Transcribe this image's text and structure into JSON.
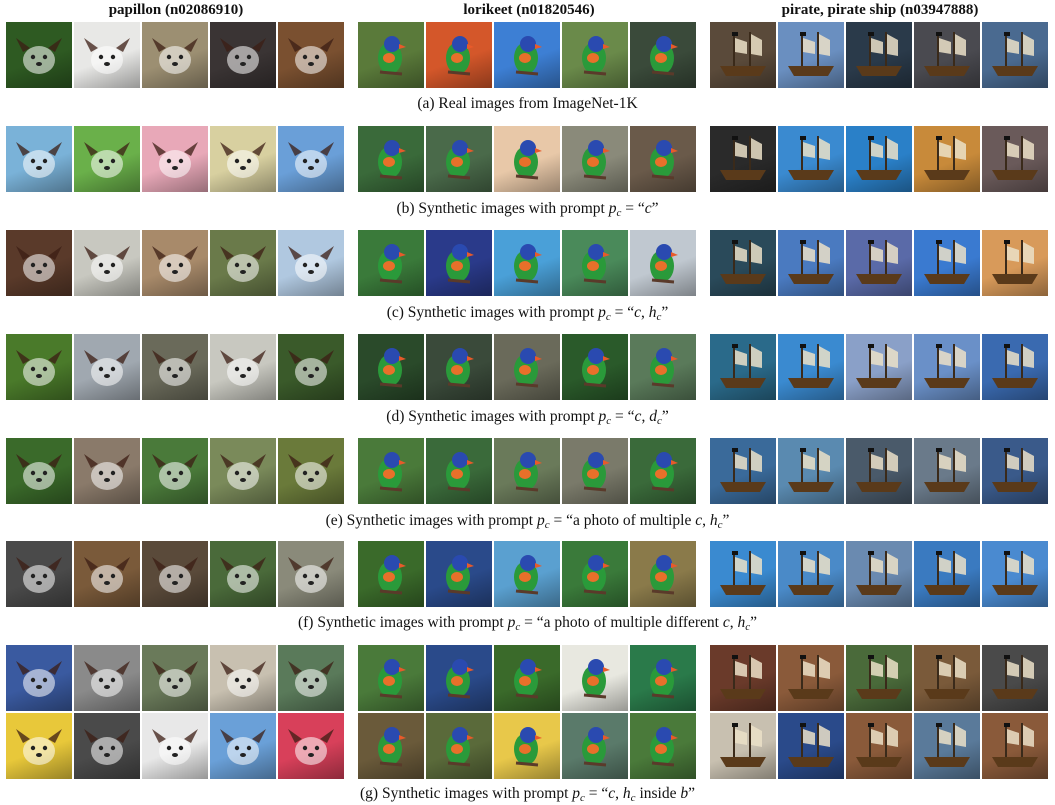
{
  "columns": [
    {
      "title": "papillon (n02086910)",
      "subject": "dog"
    },
    {
      "title": "lorikeet (n01820546)",
      "subject": "bird"
    },
    {
      "title": "pirate, pirate ship (n03947888)",
      "subject": "ship"
    }
  ],
  "captions": [
    {
      "id": "a",
      "prefix": "(a) Real images from ImageNet-1K",
      "prompt": ""
    },
    {
      "id": "b",
      "prefix": "(b) Synthetic images with prompt ",
      "prompt": "“c”"
    },
    {
      "id": "c",
      "prefix": "(c) Synthetic images with prompt ",
      "prompt": "“c, h”"
    },
    {
      "id": "d",
      "prefix": "(d) Synthetic images with prompt ",
      "prompt": "“c, d”"
    },
    {
      "id": "e",
      "prefix": "(e) Synthetic images with prompt ",
      "prompt": "“a photo of multiple c, h”"
    },
    {
      "id": "f",
      "prefix": "(f) Synthetic images with prompt ",
      "prompt": "“a photo of multiple different c, h”"
    },
    {
      "id": "g",
      "prefix": "(g) Synthetic images with prompt ",
      "prompt": "“c, h inside b”"
    }
  ],
  "rows": [
    {
      "id": "a",
      "lines": 1,
      "dog": [
        "#2e5a22",
        "#e8e8e6",
        "#9c8f72",
        "#3a3434",
        "#7a5030"
      ],
      "bird": [
        "#5a7a3a",
        "#d4572a",
        "#3d7fd4",
        "#6a8a4a",
        "#3a4a3a"
      ],
      "ship": [
        "#5a4a3a",
        "#6a8fc0",
        "#2a3a4a",
        "#4a4a50",
        "#4a6a90"
      ]
    },
    {
      "id": "b",
      "lines": 1,
      "dog": [
        "#7ab2d8",
        "#6ab04a",
        "#e8a8b8",
        "#d8d0a0",
        "#6a9fd8"
      ],
      "bird": [
        "#3a6a3a",
        "#4a6a4a",
        "#e8c8a8",
        "#8a8a7a",
        "#6a5a4a"
      ],
      "ship": [
        "#2a2a2a",
        "#3a8ad0",
        "#2a80c8",
        "#c88a3a",
        "#6a5a5a"
      ]
    },
    {
      "id": "c",
      "lines": 1,
      "dog": [
        "#5a3a2a",
        "#c8c8c0",
        "#a88a6a",
        "#6a7a4a",
        "#b0c8e0"
      ],
      "bird": [
        "#3a7a3a",
        "#2a3a8a",
        "#4aa0d8",
        "#4a8a5a",
        "#c0c8d0"
      ],
      "ship": [
        "#2a4a5a",
        "#4a7ac0",
        "#5a6aa8",
        "#3a7ad0",
        "#d89a5a"
      ]
    },
    {
      "id": "d",
      "lines": 1,
      "dog": [
        "#4a7a2a",
        "#a0a8b0",
        "#6a6a5a",
        "#c8c8c0",
        "#3a5a2a"
      ],
      "bird": [
        "#2a4a2a",
        "#3a4a3a",
        "#6a6a5a",
        "#2a5a2a",
        "#5a7a5a"
      ],
      "ship": [
        "#2a6a8a",
        "#3a8ad0",
        "#8aa0c8",
        "#6a90c8",
        "#3a6ab0"
      ]
    },
    {
      "id": "e",
      "lines": 1,
      "dog": [
        "#3a6a2a",
        "#8a7a6a",
        "#4a7a3a",
        "#7a8a5a",
        "#6a7a3a"
      ],
      "bird": [
        "#4a7a3a",
        "#3a6a3a",
        "#6a7a5a",
        "#7a7a6a",
        "#3a6a3a"
      ],
      "ship": [
        "#3a6a9a",
        "#5a8ab0",
        "#4a5a6a",
        "#6a7a8a",
        "#3a5a8a"
      ]
    },
    {
      "id": "f",
      "lines": 1,
      "dog": [
        "#4a4a4a",
        "#7a5a3a",
        "#5a4a3a",
        "#4a6a3a",
        "#8a8a7a"
      ],
      "bird": [
        "#3a6a2a",
        "#2a4a8a",
        "#5aa0d0",
        "#3a7a3a",
        "#8a7a4a"
      ],
      "ship": [
        "#3a8ad0",
        "#4a8ac8",
        "#6a8ab0",
        "#3a7ac0",
        "#4a8ad0"
      ]
    },
    {
      "id": "g",
      "lines": 2,
      "dog": [
        "#3a5aa0",
        "#8a8a8a",
        "#6a7a5a",
        "#c8c0b0",
        "#5a7a5a",
        "#e8c83a",
        "#4a4a4a",
        "#e8e8e8",
        "#6aa0d8",
        "#d8405a"
      ],
      "bird": [
        "#4a7a3a",
        "#2a4a8a",
        "#3a6a2a",
        "#e8e8e0",
        "#2a7a4a",
        "#6a5a3a",
        "#5a6a3a",
        "#e8c84a",
        "#5a7a6a",
        "#4a7a3a"
      ],
      "ship": [
        "#6a3a2a",
        "#8a5a3a",
        "#4a6a3a",
        "#7a5a3a",
        "#4a4a4a",
        "#c8c0b0",
        "#2a4a8a",
        "#8a5a3a",
        "#5a7a9a",
        "#8a5a3a"
      ]
    }
  ],
  "caption_subscripts": {
    "h": "c",
    "d": "c",
    "p": "c"
  }
}
